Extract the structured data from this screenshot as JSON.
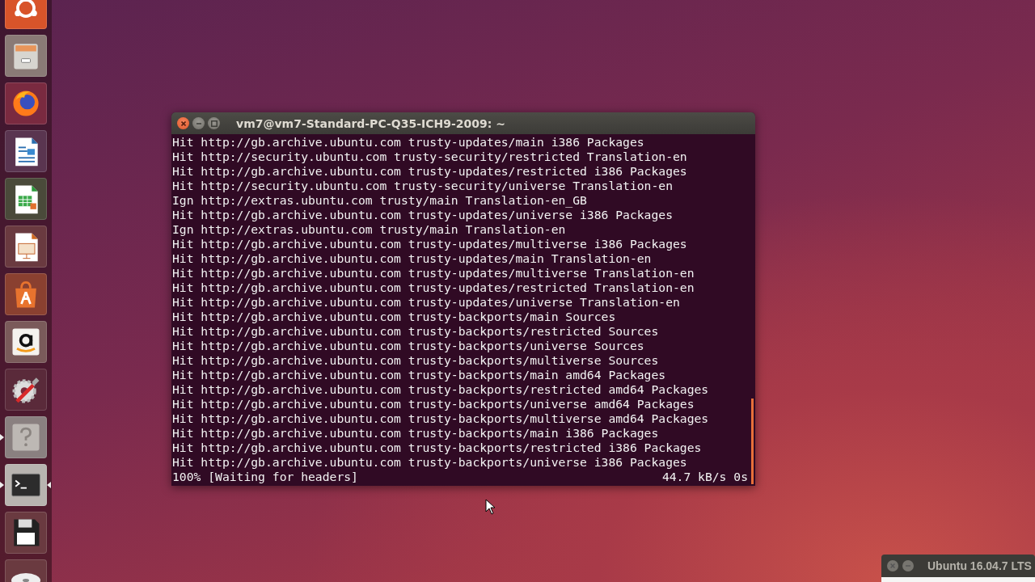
{
  "launcher": {
    "items": [
      {
        "kind": "ubuntu",
        "running": false,
        "focused": false
      },
      {
        "kind": "files",
        "running": false,
        "focused": false
      },
      {
        "kind": "firefox",
        "running": false,
        "focused": false
      },
      {
        "kind": "writer",
        "running": false,
        "focused": false
      },
      {
        "kind": "calc",
        "running": false,
        "focused": false
      },
      {
        "kind": "impress",
        "running": false,
        "focused": false
      },
      {
        "kind": "software",
        "running": false,
        "focused": false
      },
      {
        "kind": "amazon",
        "running": false,
        "focused": false
      },
      {
        "kind": "settings",
        "running": false,
        "focused": false
      },
      {
        "kind": "help",
        "running": true,
        "focused": false
      },
      {
        "kind": "terminal",
        "running": true,
        "focused": true
      },
      {
        "kind": "floppy",
        "running": false,
        "focused": false
      },
      {
        "kind": "dvd",
        "running": false,
        "focused": false
      }
    ]
  },
  "terminal": {
    "title": "vm7@vm7-Standard-PC-Q35-ICH9-2009: ~",
    "lines": [
      "Hit http://gb.archive.ubuntu.com trusty-updates/main i386 Packages",
      "Hit http://security.ubuntu.com trusty-security/restricted Translation-en",
      "Hit http://gb.archive.ubuntu.com trusty-updates/restricted i386 Packages",
      "Hit http://security.ubuntu.com trusty-security/universe Translation-en",
      "Ign http://extras.ubuntu.com trusty/main Translation-en_GB",
      "Hit http://gb.archive.ubuntu.com trusty-updates/universe i386 Packages",
      "Ign http://extras.ubuntu.com trusty/main Translation-en",
      "Hit http://gb.archive.ubuntu.com trusty-updates/multiverse i386 Packages",
      "Hit http://gb.archive.ubuntu.com trusty-updates/main Translation-en",
      "Hit http://gb.archive.ubuntu.com trusty-updates/multiverse Translation-en",
      "Hit http://gb.archive.ubuntu.com trusty-updates/restricted Translation-en",
      "Hit http://gb.archive.ubuntu.com trusty-updates/universe Translation-en",
      "Hit http://gb.archive.ubuntu.com trusty-backports/main Sources",
      "Hit http://gb.archive.ubuntu.com trusty-backports/restricted Sources",
      "Hit http://gb.archive.ubuntu.com trusty-backports/universe Sources",
      "Hit http://gb.archive.ubuntu.com trusty-backports/multiverse Sources",
      "Hit http://gb.archive.ubuntu.com trusty-backports/main amd64 Packages",
      "Hit http://gb.archive.ubuntu.com trusty-backports/restricted amd64 Packages",
      "Hit http://gb.archive.ubuntu.com trusty-backports/universe amd64 Packages",
      "Hit http://gb.archive.ubuntu.com trusty-backports/multiverse amd64 Packages",
      "Hit http://gb.archive.ubuntu.com trusty-backports/main i386 Packages",
      "Hit http://gb.archive.ubuntu.com trusty-backports/restricted i386 Packages",
      "Hit http://gb.archive.ubuntu.com trusty-backports/universe i386 Packages"
    ],
    "status": {
      "progress": "100% [Waiting for headers]",
      "speed": "44.7 kB/s 0s"
    }
  },
  "mini_window": {
    "title": "Ubuntu 16.04.7 LTS"
  }
}
